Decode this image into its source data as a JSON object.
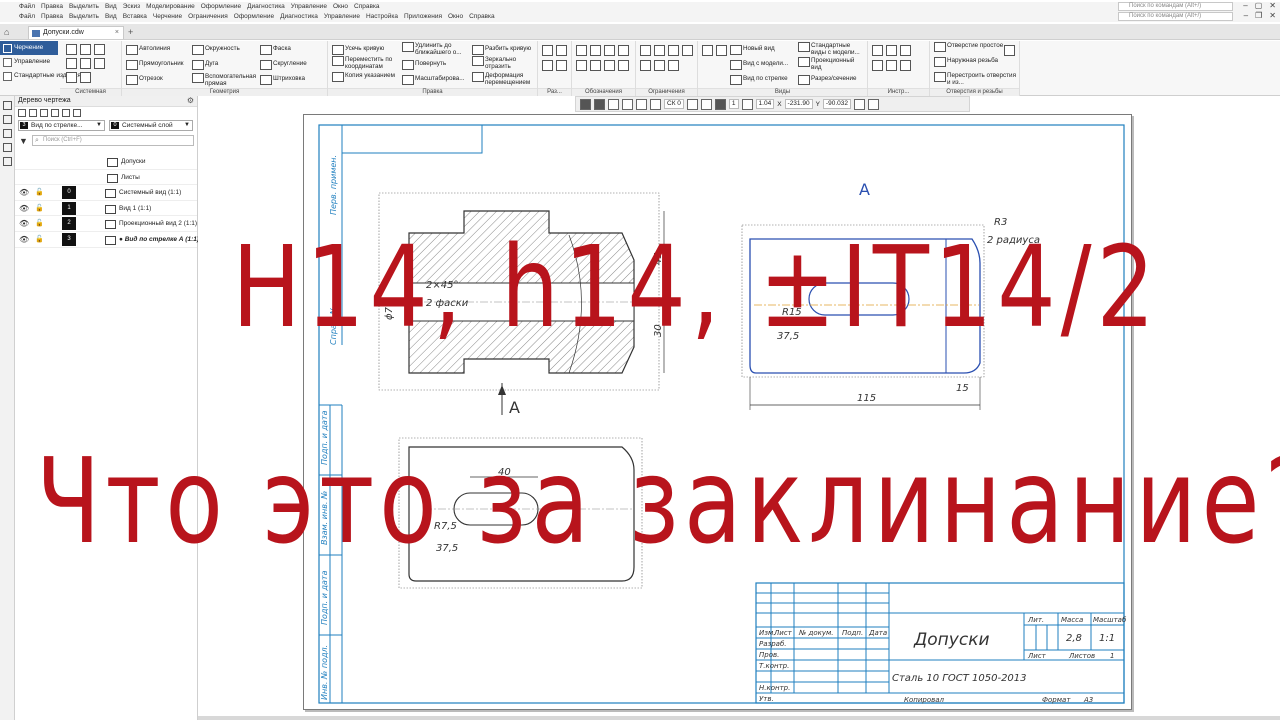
{
  "menu": {
    "items": [
      "Файл",
      "Правка",
      "Выделить",
      "Вид",
      "Эскиз",
      "Моделирование",
      "Оформление",
      "Диагностика",
      "Управление",
      "Окно",
      "Справка"
    ],
    "items2": [
      "Файл",
      "Правка",
      "Выделить",
      "Вид",
      "Вставка",
      "Черчение",
      "Ограничения",
      "Оформление",
      "Диагностика",
      "Управление",
      "Настройка",
      "Приложения",
      "Окно",
      "Справка"
    ],
    "search1": "Поиск по командам (Alt+/)",
    "search2": "Поиск по командам (Alt+/)"
  },
  "document_tab": {
    "label": "Допуски.cdw",
    "close": "×"
  },
  "ribbon": {
    "modes": [
      "Черчение",
      "Управление",
      "Стандартные изделия"
    ],
    "groups": {
      "system": "Системная",
      "geometry": "Геометрия",
      "edit": "Правка",
      "sizes": "Раз...",
      "designation": "Обозначения",
      "constraints": "Ограничения",
      "views": "Виды",
      "tools": "Инстр...",
      "holes": "Отверстия и резьбы"
    },
    "geometry_items": [
      "Автолиния",
      "Окружность",
      "Фаска",
      "Прямоугольник",
      "Дуга",
      "Скругление",
      "Отрезок",
      "Вспомогательная прямая",
      "Штриховка"
    ],
    "edit_items": [
      "Усечь кривую",
      "Удлинить до ближайшего о...",
      "Разбить кривую",
      "Переместить по координатам",
      "Повернуть",
      "Зеркально отразить",
      "Копия указанием",
      "Масштабирова...",
      "Деформация перемещением"
    ],
    "views_items": [
      "Новый вид",
      "Стандартные виды с модели...",
      "Вид с модели...",
      "Проекционный вид",
      "Вид по стрелке",
      "Разрез/сечение"
    ],
    "holes_items": [
      "Отверстие простое",
      "Наружная резьба",
      "Перестроить отверстия и из..."
    ]
  },
  "toolbar2": {
    "sk": "СК 0",
    "layer": "1",
    "zoom": "1.04",
    "x_label": "X",
    "x_value": "-231.90",
    "y_label": "Y",
    "y_value": "-90.032"
  },
  "tree": {
    "title": "Дерево чертежа",
    "view_select": "Вид по стрелке...",
    "view_num": "3",
    "layer_select": "Системный слой",
    "layer_num": "0",
    "search_placeholder": "Поиск (Ctrl+F)",
    "root": "Допуски",
    "sheets": "Листы",
    "rows": [
      {
        "num": "0",
        "name": "Системный вид (1:1)"
      },
      {
        "num": "1",
        "name": "Вид 1 (1:1)"
      },
      {
        "num": "2",
        "name": "Проекционный вид 2 (1:1)"
      },
      {
        "num": "3",
        "name": "● Вид по стрелке А (1:1)"
      }
    ]
  },
  "drawing": {
    "view_label_A": "A",
    "arrow_label": "A",
    "dims": {
      "d45": "45",
      "d30": "30",
      "chamfer": "2×45°",
      "chamfer_note": "2 фаски",
      "phi70": "ϕ70",
      "r3": "R3",
      "radius_word": "2 радиуса",
      "r15": "R15",
      "d37a": "37,5",
      "d115": "115",
      "d15": "15",
      "d40": "40",
      "r75": "R7,5",
      "d37b": "37,5"
    },
    "side_labels": [
      "Перв. примен.",
      "Справ. №",
      "Подп. и дата",
      "Взам. инв. №",
      "Инв. № дубл.",
      "Подп. и дата",
      "Инв. № подл."
    ],
    "title_block": {
      "name": "Допуски",
      "material": "Сталь 10  ГОСТ 1050-2013",
      "headers": [
        "Лит.",
        "Масса",
        "Масштаб"
      ],
      "mass": "2,8",
      "scale": "1:1",
      "sheet_label": "Лист",
      "sheets_label": "Листов",
      "sheets_count": "1",
      "rows": [
        "Изм.",
        "Лист",
        "№ докум.",
        "Подп.",
        "Дата"
      ],
      "roles": [
        "Разраб.",
        "Пров.",
        "Т.контр.",
        "Н.контр.",
        "Утв."
      ],
      "copied": "Копировал",
      "format": "Формат",
      "format_value": "A3"
    }
  },
  "overlay": {
    "line1": "H14, h14, ±IT14/2",
    "line2": "Что это за заклинание?"
  },
  "colors": {
    "accent": "#2f5d9a",
    "overlay_red": "#b8141c",
    "frame_blue": "#1f7fbf",
    "outline_blue": "#2a4fb0"
  }
}
